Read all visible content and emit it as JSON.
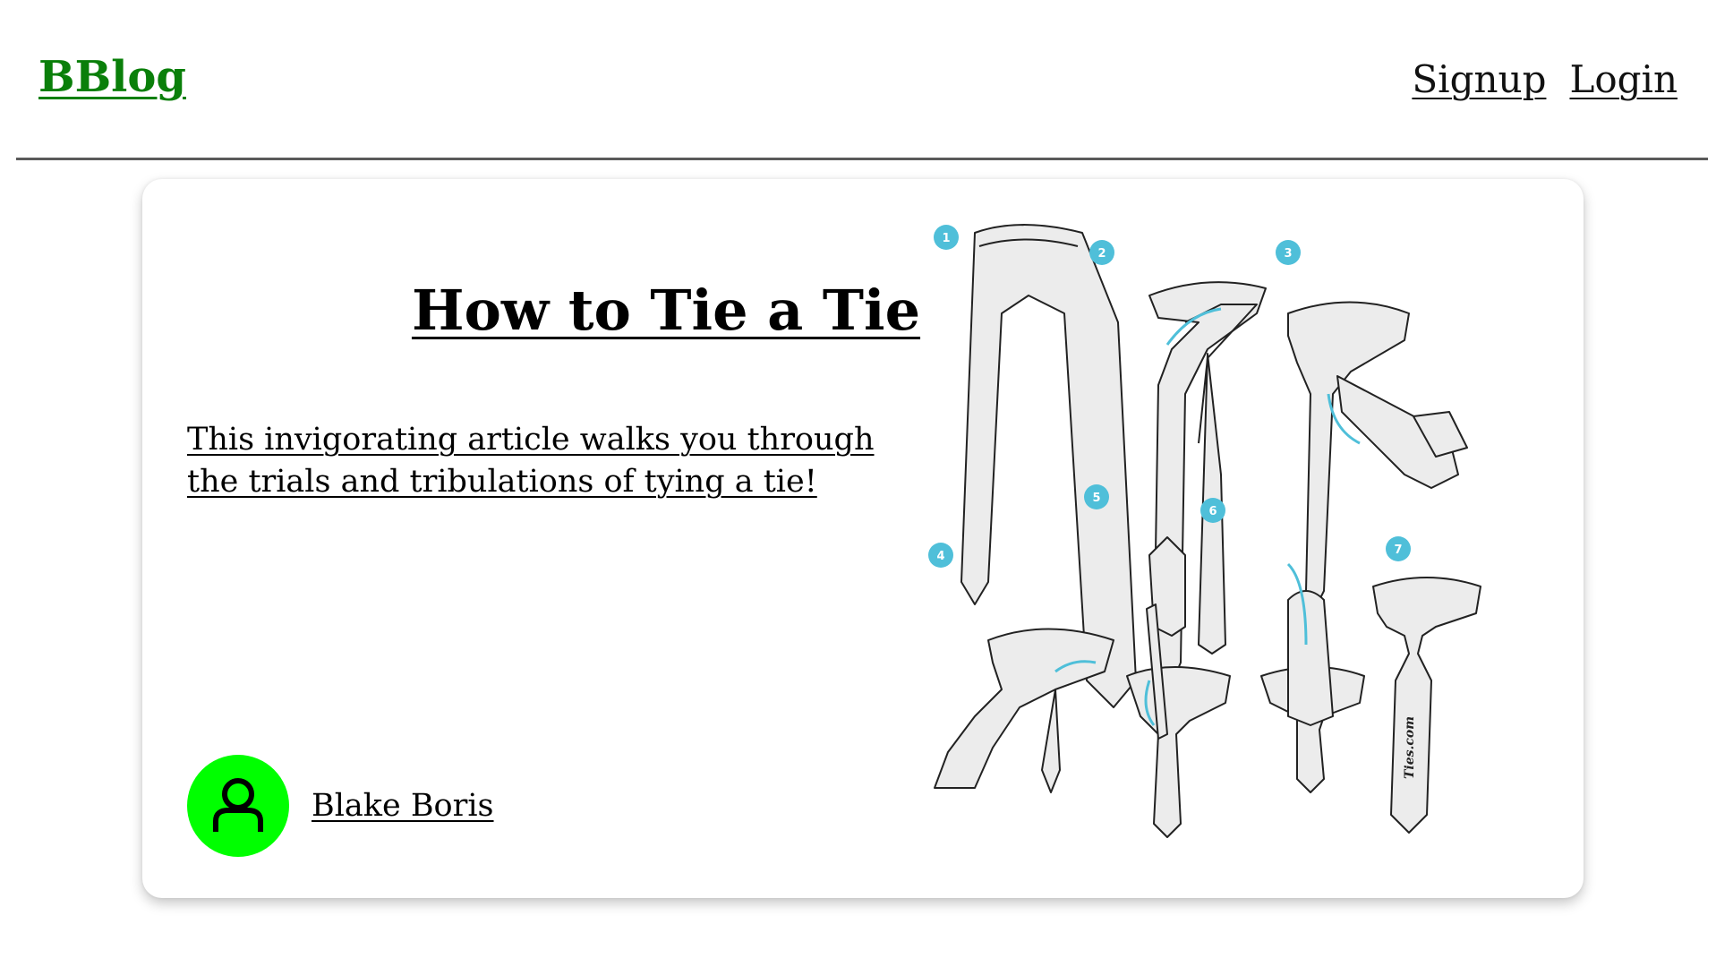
{
  "header": {
    "logo": "BBlog",
    "nav": {
      "signup": "Signup",
      "login": "Login"
    }
  },
  "post": {
    "title": "How to Tie a Tie",
    "summary": "This invigorating article walks you through the trials and tribulations of tying a tie!",
    "author": "Blake Boris",
    "avatar_icon": "person-icon",
    "illustration": {
      "steps": [
        "1",
        "2",
        "3",
        "4",
        "5",
        "6",
        "7"
      ],
      "watermark": "Ties.com"
    }
  },
  "colors": {
    "logo": "#0a7f0a",
    "avatar_bg": "#00ff00",
    "step_badge": "#4fbfd9",
    "divider": "#5a5a5a"
  }
}
